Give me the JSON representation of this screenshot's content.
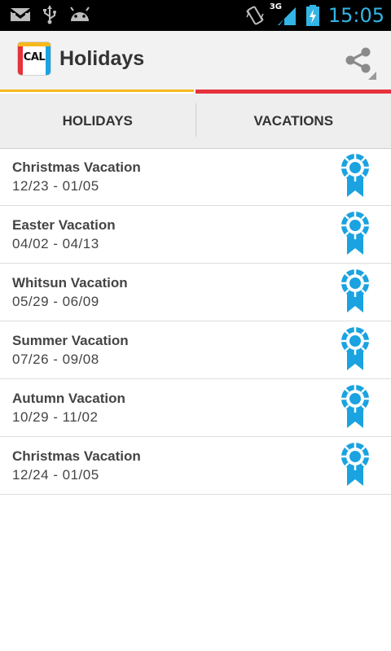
{
  "status_bar": {
    "time": "15:05",
    "network": "3G",
    "icons": [
      "gmail-icon",
      "usb-icon",
      "android-icon",
      "vibrate-icon",
      "signal-icon",
      "battery-charging-icon"
    ]
  },
  "action_bar": {
    "logo_text": "CAL",
    "title": "Holidays",
    "share_icon": "share-icon"
  },
  "colors": {
    "accent_yellow": "#f6b81c",
    "accent_red": "#e5323c",
    "ribbon_blue": "#1aa3e0",
    "clock_blue": "#33b5e5"
  },
  "tabs": [
    {
      "label": "HOLIDAYS"
    },
    {
      "label": "VACATIONS"
    }
  ],
  "vacations": [
    {
      "title": "Christmas Vacation",
      "dates": "12/23 - 01/05",
      "icon": "ribbon-award-icon"
    },
    {
      "title": "Easter Vacation",
      "dates": "04/02 - 04/13",
      "icon": "ribbon-award-icon"
    },
    {
      "title": "Whitsun Vacation",
      "dates": "05/29 - 06/09",
      "icon": "ribbon-award-icon"
    },
    {
      "title": "Summer Vacation",
      "dates": "07/26 - 09/08",
      "icon": "ribbon-award-icon"
    },
    {
      "title": "Autumn Vacation",
      "dates": "10/29 - 11/02",
      "icon": "ribbon-award-icon"
    },
    {
      "title": "Christmas Vacation",
      "dates": "12/24 - 01/05",
      "icon": "ribbon-award-icon"
    }
  ]
}
